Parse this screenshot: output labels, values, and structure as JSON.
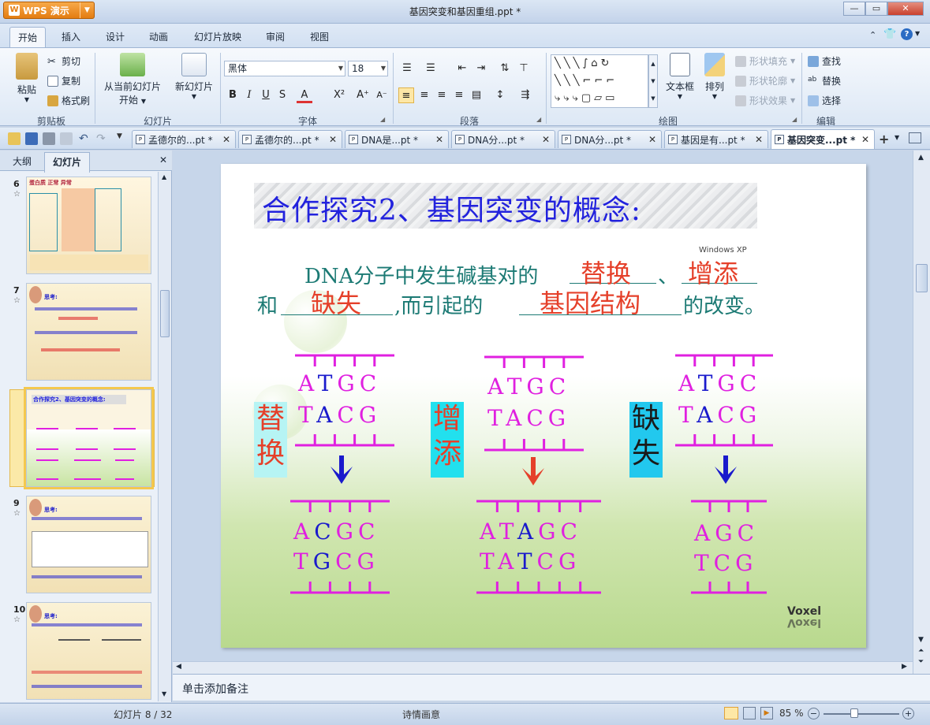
{
  "app": {
    "name": "WPS 演示",
    "doc_title": "基因突变和基因重组.ppt *"
  },
  "ribbon_tabs": [
    "开始",
    "插入",
    "设计",
    "动画",
    "幻灯片放映",
    "审阅",
    "视图"
  ],
  "ribbon": {
    "clipboard": {
      "paste": "粘贴",
      "cut": "剪切",
      "copy": "复制",
      "format_painter": "格式刷",
      "label": "剪贴板"
    },
    "slides": {
      "from_current": "从当前幻灯片",
      "start": "开始",
      "new_slide": "新幻灯片",
      "label": "幻灯片"
    },
    "font": {
      "name": "黑体",
      "size": "18",
      "label": "字体"
    },
    "paragraph": {
      "label": "段落"
    },
    "drawing": {
      "textbox": "文本框",
      "arrange": "排列",
      "shape_fill": "形状填充",
      "shape_outline": "形状轮廓",
      "shape_effect": "形状效果",
      "label": "绘图"
    },
    "editing": {
      "find": "查找",
      "replace": "替换",
      "select": "选择",
      "label": "编辑"
    }
  },
  "doc_tabs": [
    "孟德尔的...pt *",
    "孟德尔的...pt *",
    "DNA是...pt *",
    "DNA分...pt *",
    "DNA分...pt *",
    "基因是有...pt *",
    "基因突变...pt *"
  ],
  "left_panel": {
    "tab_outline": "大纲",
    "tab_slides": "幻灯片",
    "thumbs": [
      {
        "num": "6",
        "title": "蛋白质 正常 异常"
      },
      {
        "num": "7",
        "title": "思考:"
      },
      {
        "num": "8",
        "title": "合作探究2、基因突变的概念:"
      },
      {
        "num": "9",
        "title": "思考:"
      },
      {
        "num": "10",
        "title": "思考:"
      }
    ]
  },
  "slide": {
    "title": "合作探究2、基因突变的概念:",
    "watermark": "Windows XP",
    "line1_prefix": "DNA分子中发生碱基对的",
    "ans1": "替换",
    "sep1": "、",
    "ans2": "增添",
    "line2_prefix": "和",
    "ans3": "缺失",
    "line2_mid": ",而引起的",
    "ans4": "基因结构",
    "line2_suffix": "的改变。",
    "labels": {
      "sub": "替换",
      "add": "增添",
      "del": "缺失"
    },
    "dna": {
      "orig_top": "ATGC",
      "orig_bot": "TACG",
      "sub_top": "ACGC",
      "sub_bot": "TGCG",
      "add_top": "ATAGC",
      "add_bot": "TATCG",
      "del_top": "AGC",
      "del_bot": "TCG"
    },
    "brand": "Voxel"
  },
  "notes_placeholder": "单击添加备注",
  "status": {
    "slide_pos": "幻灯片 8 / 32",
    "theme": "诗情画意",
    "zoom": "85 %"
  },
  "colors": {
    "magenta": "#e020e0",
    "blue": "#1a1acc",
    "red": "#e5402a",
    "teal": "#1c7a74"
  }
}
